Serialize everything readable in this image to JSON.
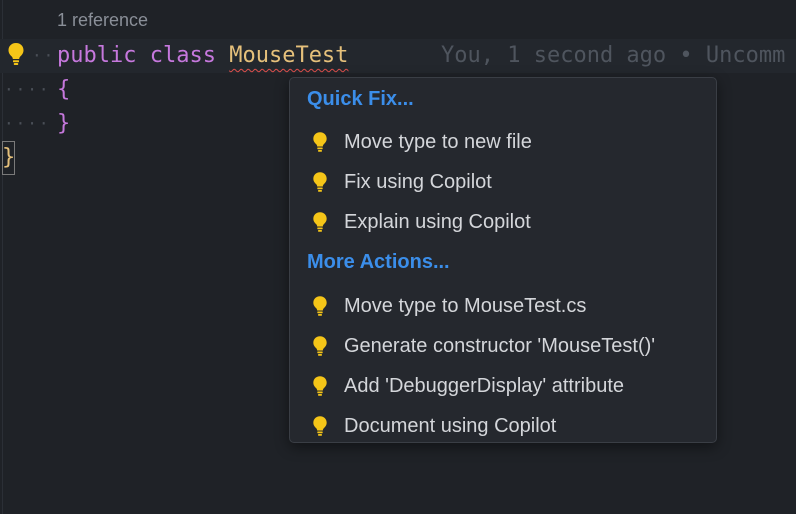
{
  "codelens": {
    "references": "1 reference"
  },
  "code": {
    "line1": {
      "keyword_public": "public",
      "keyword_class": "class",
      "class_name": "MouseTest",
      "blame": "You, 1 second ago • Uncomm"
    },
    "line2": {
      "text": "{"
    },
    "line3": {
      "text": "}"
    },
    "line4": {
      "text": "}"
    }
  },
  "popup": {
    "quick_fix_header": "Quick Fix...",
    "quick_fix_items": [
      {
        "label": "Move type to new file",
        "icon": "lightbulb-icon"
      },
      {
        "label": "Fix using Copilot",
        "icon": "lightbulb-icon"
      },
      {
        "label": "Explain using Copilot",
        "icon": "lightbulb-icon"
      }
    ],
    "more_actions_header": "More Actions...",
    "more_actions_items": [
      {
        "label": "Move type to MouseTest.cs",
        "icon": "lightbulb-icon"
      },
      {
        "label": "Generate constructor 'MouseTest()'",
        "icon": "lightbulb-icon"
      },
      {
        "label": "Add 'DebuggerDisplay' attribute",
        "icon": "lightbulb-icon"
      },
      {
        "label": "Document using Copilot",
        "icon": "lightbulb-icon"
      }
    ]
  },
  "colors": {
    "background": "#1f2227",
    "keyword": "#c678dd",
    "class_name": "#e5c07b",
    "header_accent": "#3b8eea",
    "bulb": "#f5c518"
  }
}
